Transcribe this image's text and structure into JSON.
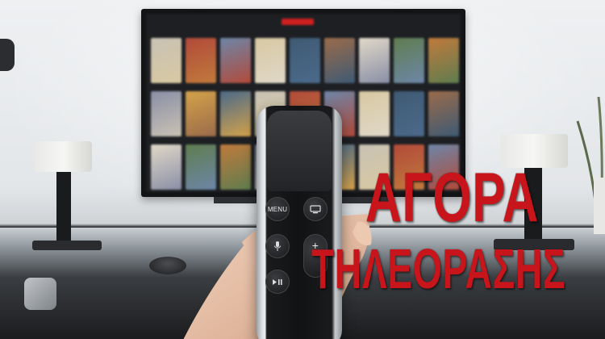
{
  "overlay": {
    "line1": "ΑΓΟΡΑ",
    "line2": "ΤΗΛΕΟΡΑΣΗΣ"
  },
  "remote": {
    "menu_label": "MENU",
    "tv_icon": "tv-icon",
    "mic_icon": "microphone-icon",
    "plus_label": "+",
    "play_pause_icon": "play-pause-icon"
  },
  "colors": {
    "title_red": "#c8141b",
    "tv_logo_red": "#d01f1f"
  }
}
